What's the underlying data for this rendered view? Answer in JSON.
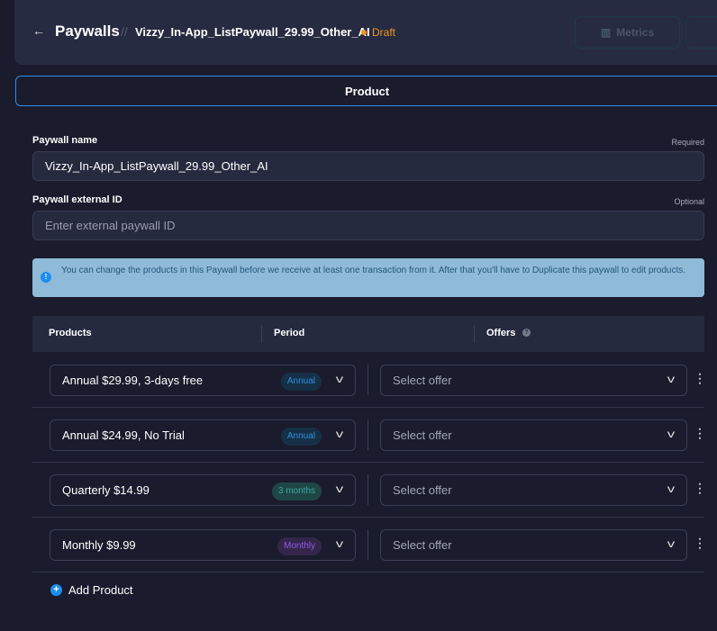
{
  "header": {
    "back": "←",
    "title": "Paywalls",
    "separator": "//",
    "paywall_name": "Vizzy_In-App_ListPaywall_29.99_Other_AI",
    "status": "Draft",
    "metrics": "Metrics"
  },
  "tabs": {
    "active": "Product"
  },
  "form": {
    "name_label": "Paywall name",
    "name_hint": "Required",
    "name_value": "Vizzy_In-App_ListPaywall_29.99_Other_AI",
    "ext_label": "Paywall external ID",
    "ext_hint": "Optional",
    "ext_placeholder": "Enter external paywall ID"
  },
  "info": {
    "icon": "!",
    "text": "You can change the products in this Paywall before we receive at least one transaction from it. After that you'll have to Duplicate this paywall to edit products."
  },
  "table": {
    "headers": [
      "Products",
      "Period",
      "Offers"
    ],
    "rows": [
      {
        "product": "Annual $29.99, 3-days free",
        "period": "Annual",
        "offer": "Select offer",
        "badge_bg": "#163046",
        "badge_fg": "#2e8fe0"
      },
      {
        "product": "Annual $24.99, No Trial",
        "period": "Annual",
        "offer": "Select offer",
        "badge_bg": "#163046",
        "badge_fg": "#2e8fe0"
      },
      {
        "product": "Quarterly $14.99",
        "period": "3 months",
        "offer": "Select offer",
        "badge_bg": "#1f4646",
        "badge_fg": "#3aa6a0"
      },
      {
        "product": "Monthly $9.99",
        "period": "Monthly",
        "offer": "Select offer",
        "badge_bg": "#33264a",
        "badge_fg": "#9157e8"
      }
    ]
  },
  "add_product": "Add Product"
}
